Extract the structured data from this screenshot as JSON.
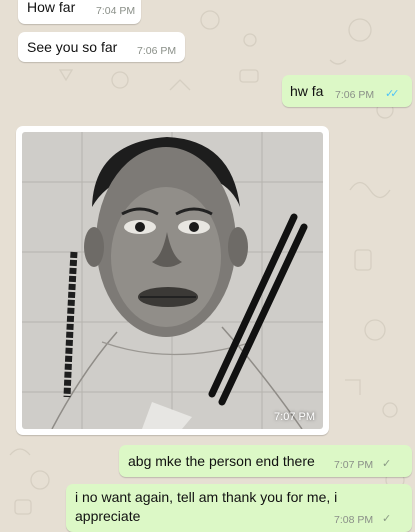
{
  "messages": [
    {
      "text": "How far",
      "time": "7:04 PM"
    },
    {
      "text": "See you so far",
      "time": "7:06 PM"
    },
    {
      "text": "hw fa",
      "time": "7:06 PM",
      "ticks": "✓✓"
    },
    {
      "time": "7:07 PM"
    },
    {
      "text": "abg mke the person end there",
      "time": "7:07 PM",
      "ticks": "✓"
    },
    {
      "text_line1": "i no want again, tell am thank you for me, i",
      "text_line2": "appreciate",
      "time": "7:08 PM",
      "ticks": "✓"
    }
  ],
  "colors": {
    "incoming_bubble": "#ffffff",
    "outgoing_bubble": "#dcf8c6",
    "wallpaper": "#e6dfd3",
    "read_ticks": "#4fc3f7",
    "sent_ticks": "#8a9a84"
  },
  "icons": [
    "read-check-icon",
    "sent-check-icon"
  ]
}
